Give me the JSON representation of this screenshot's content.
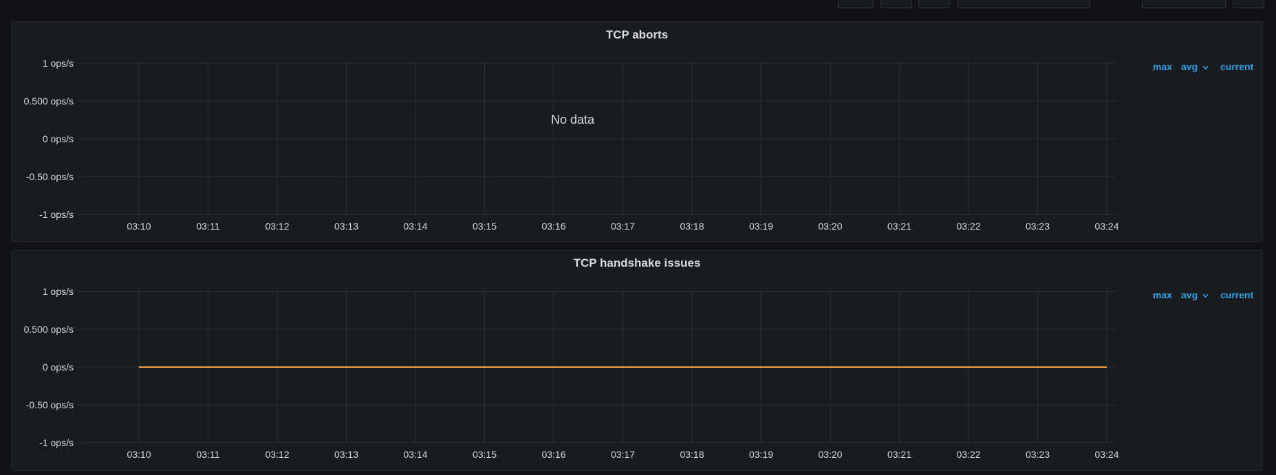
{
  "colors": {
    "background": "#111217",
    "panel": "#181b1f",
    "grid": "#2c3037",
    "text": "#d8d9da",
    "legend": "#33a2e5",
    "series": "#f2a24a"
  },
  "legend": {
    "max": "max",
    "avg": "avg",
    "current": "current",
    "avg_icon": "chevron-down-icon"
  },
  "panels": [
    {
      "title": "TCP aborts",
      "no_data": "No data"
    },
    {
      "title": "TCP handshake issues",
      "no_data": ""
    }
  ],
  "chart_data": [
    {
      "type": "line",
      "title": "TCP aborts",
      "ylim": [
        -1,
        1
      ],
      "y_ticks": [
        1,
        0.5,
        0,
        -0.5,
        -1
      ],
      "y_tick_labels": [
        "1 ops/s",
        "0.500 ops/s",
        "0 ops/s",
        "-0.50 ops/s",
        "-1 ops/s"
      ],
      "x_tick_labels": [
        "03:10",
        "03:11",
        "03:12",
        "03:13",
        "03:14",
        "03:15",
        "03:16",
        "03:17",
        "03:18",
        "03:19",
        "03:20",
        "03:21",
        "03:22",
        "03:23",
        "03:24"
      ],
      "grid": true,
      "series": [],
      "annotation": "No data"
    },
    {
      "type": "line",
      "title": "TCP handshake issues",
      "ylim": [
        -1,
        1
      ],
      "y_ticks": [
        1,
        0.5,
        0,
        -0.5,
        -1
      ],
      "y_tick_labels": [
        "1 ops/s",
        "0.500 ops/s",
        "0 ops/s",
        "-0.50 ops/s",
        "-1 ops/s"
      ],
      "x_tick_labels": [
        "03:10",
        "03:11",
        "03:12",
        "03:13",
        "03:14",
        "03:15",
        "03:16",
        "03:17",
        "03:18",
        "03:19",
        "03:20",
        "03:21",
        "03:22",
        "03:23",
        "03:24"
      ],
      "grid": true,
      "series": [
        {
          "color": "#f2a24a",
          "x": [
            "03:10",
            "03:24"
          ],
          "values": [
            0,
            0
          ]
        }
      ]
    }
  ]
}
